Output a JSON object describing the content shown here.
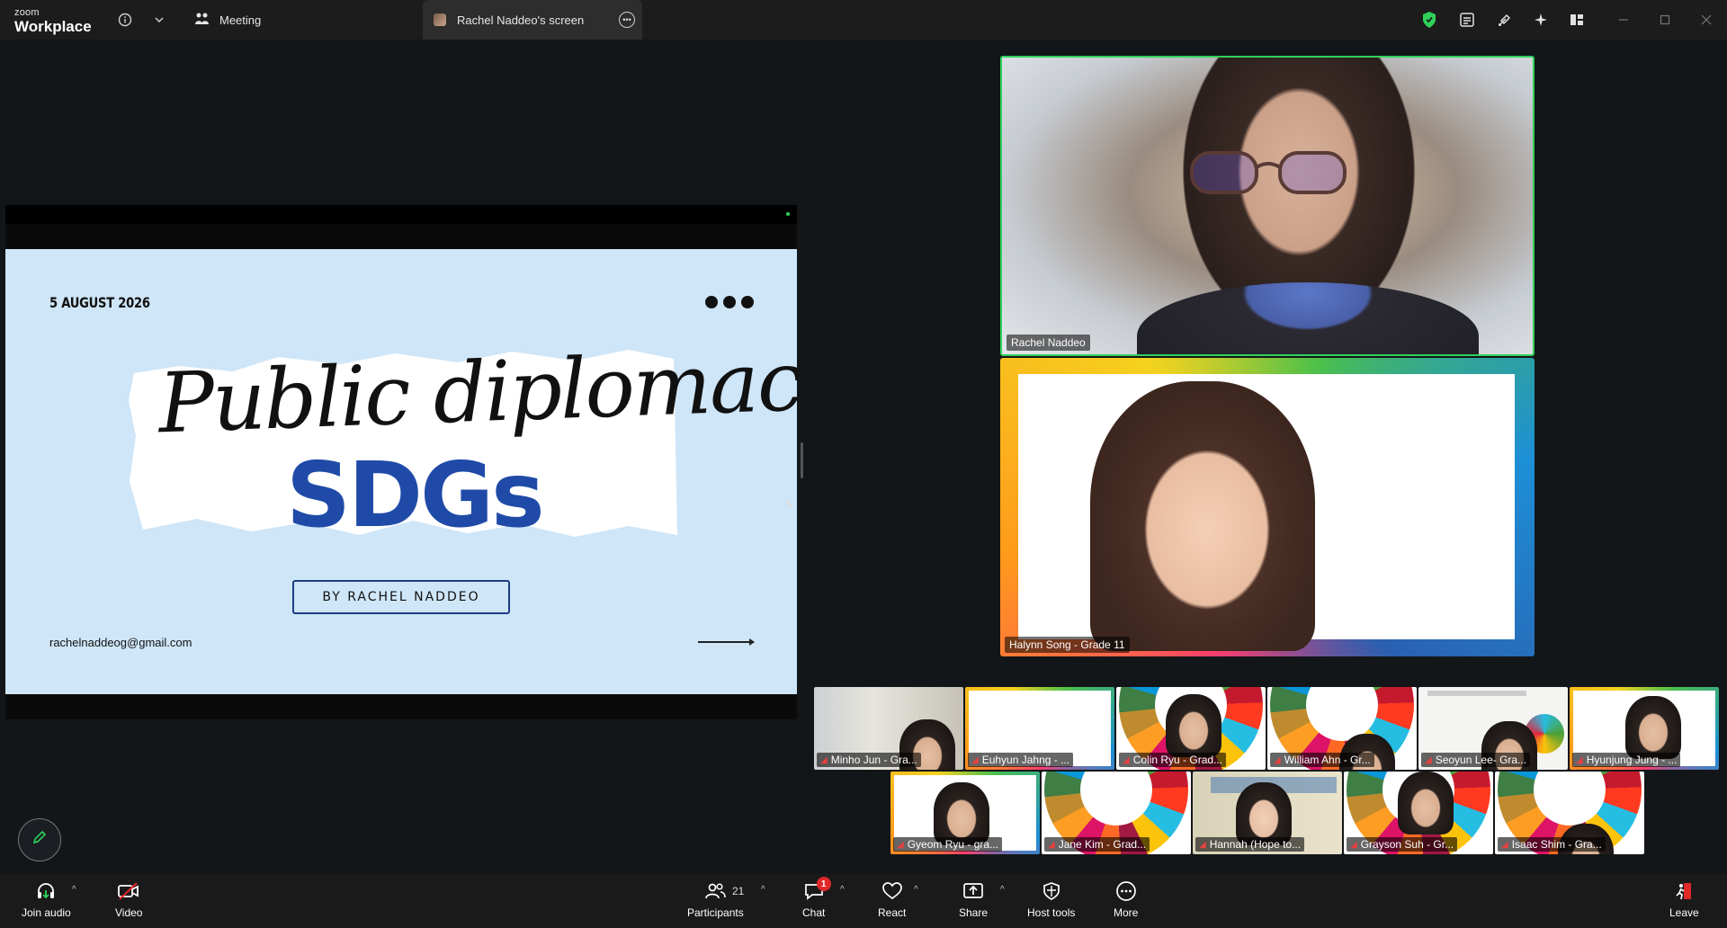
{
  "app": {
    "brand_small": "zoom",
    "brand_large": "Workplace"
  },
  "tabs": {
    "meeting": "Meeting",
    "screen": "Rachel Naddeo's screen"
  },
  "slide": {
    "date": "5 AUGUST 2026",
    "title_script": "Public diplomacy",
    "title_main": "SDGs",
    "byline": "BY RACHEL NADDEO",
    "email": "rachelnaddeog@gmail.com",
    "accent_color": "#1f4aa8",
    "background_color": "#cfe6f8"
  },
  "videos": {
    "speaker": "Rachel Naddeo",
    "second": "Halynn Song - Grade 11"
  },
  "gallery": [
    {
      "name": "Minho Jun - Gra...",
      "bg": "room"
    },
    {
      "name": "Euhyun Jahng - ...",
      "bg": "white"
    },
    {
      "name": "Colin Ryu - Grad...",
      "bg": "sdg"
    },
    {
      "name": "William Ahn - Gr...",
      "bg": "sdg"
    },
    {
      "name": "Seoyun Lee- Gra...",
      "bg": "slide"
    },
    {
      "name": "Hyunjung Jung - ...",
      "bg": "white"
    },
    {
      "name": "Gyeom Ryu - gra...",
      "bg": "white"
    },
    {
      "name": "Jane Kim - Grad...",
      "bg": "sdg"
    },
    {
      "name": "Hannah (Hope to...",
      "bg": "poster"
    },
    {
      "name": "Grayson Suh - Gr...",
      "bg": "sdg"
    },
    {
      "name": "Isaac Shim - Gra...",
      "bg": "sdg"
    }
  ],
  "toolbar": {
    "join_audio": "Join audio",
    "video": "Video",
    "participants": "Participants",
    "participants_count": "21",
    "chat": "Chat",
    "chat_badge": "1",
    "react": "React",
    "share": "Share",
    "host_tools": "Host tools",
    "more": "More",
    "leave": "Leave"
  },
  "colors": {
    "active_border": "#2fd15a",
    "leave": "#e02828"
  }
}
